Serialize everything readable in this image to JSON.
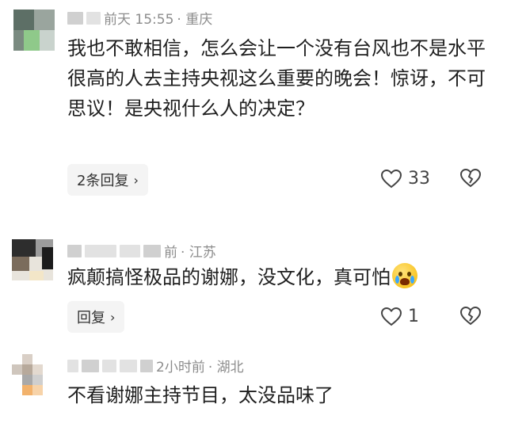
{
  "comments": [
    {
      "meta_time": "前天 15:55",
      "meta_location": "· 重庆",
      "text": "我也不敢相信，怎么会让一个没有台风也不是水平很高的人去主持央视这么重要的晚会！惊讶，不可思议！是央视什么人的决定？",
      "reply_label": "2条回复",
      "like_count": "33"
    },
    {
      "meta_time": "前",
      "meta_location": "· 江苏",
      "text": "疯颠搞怪极品的谢娜，没文化，真可怕",
      "reply_label": "回复",
      "like_count": "1"
    },
    {
      "meta_time": "2小时前",
      "meta_location": "· 湖北",
      "text": "不看谢娜主持节目，太没品味了"
    }
  ],
  "icons": {
    "reply_chevron": "chevron-right-icon",
    "like": "heart-icon",
    "dislike": "broken-heart-icon",
    "emoji": "crying-face-emoji"
  },
  "colors": {
    "meta": "#8c8c8c",
    "text": "#1f1f1f",
    "pill_bg": "#f4f4f4"
  }
}
